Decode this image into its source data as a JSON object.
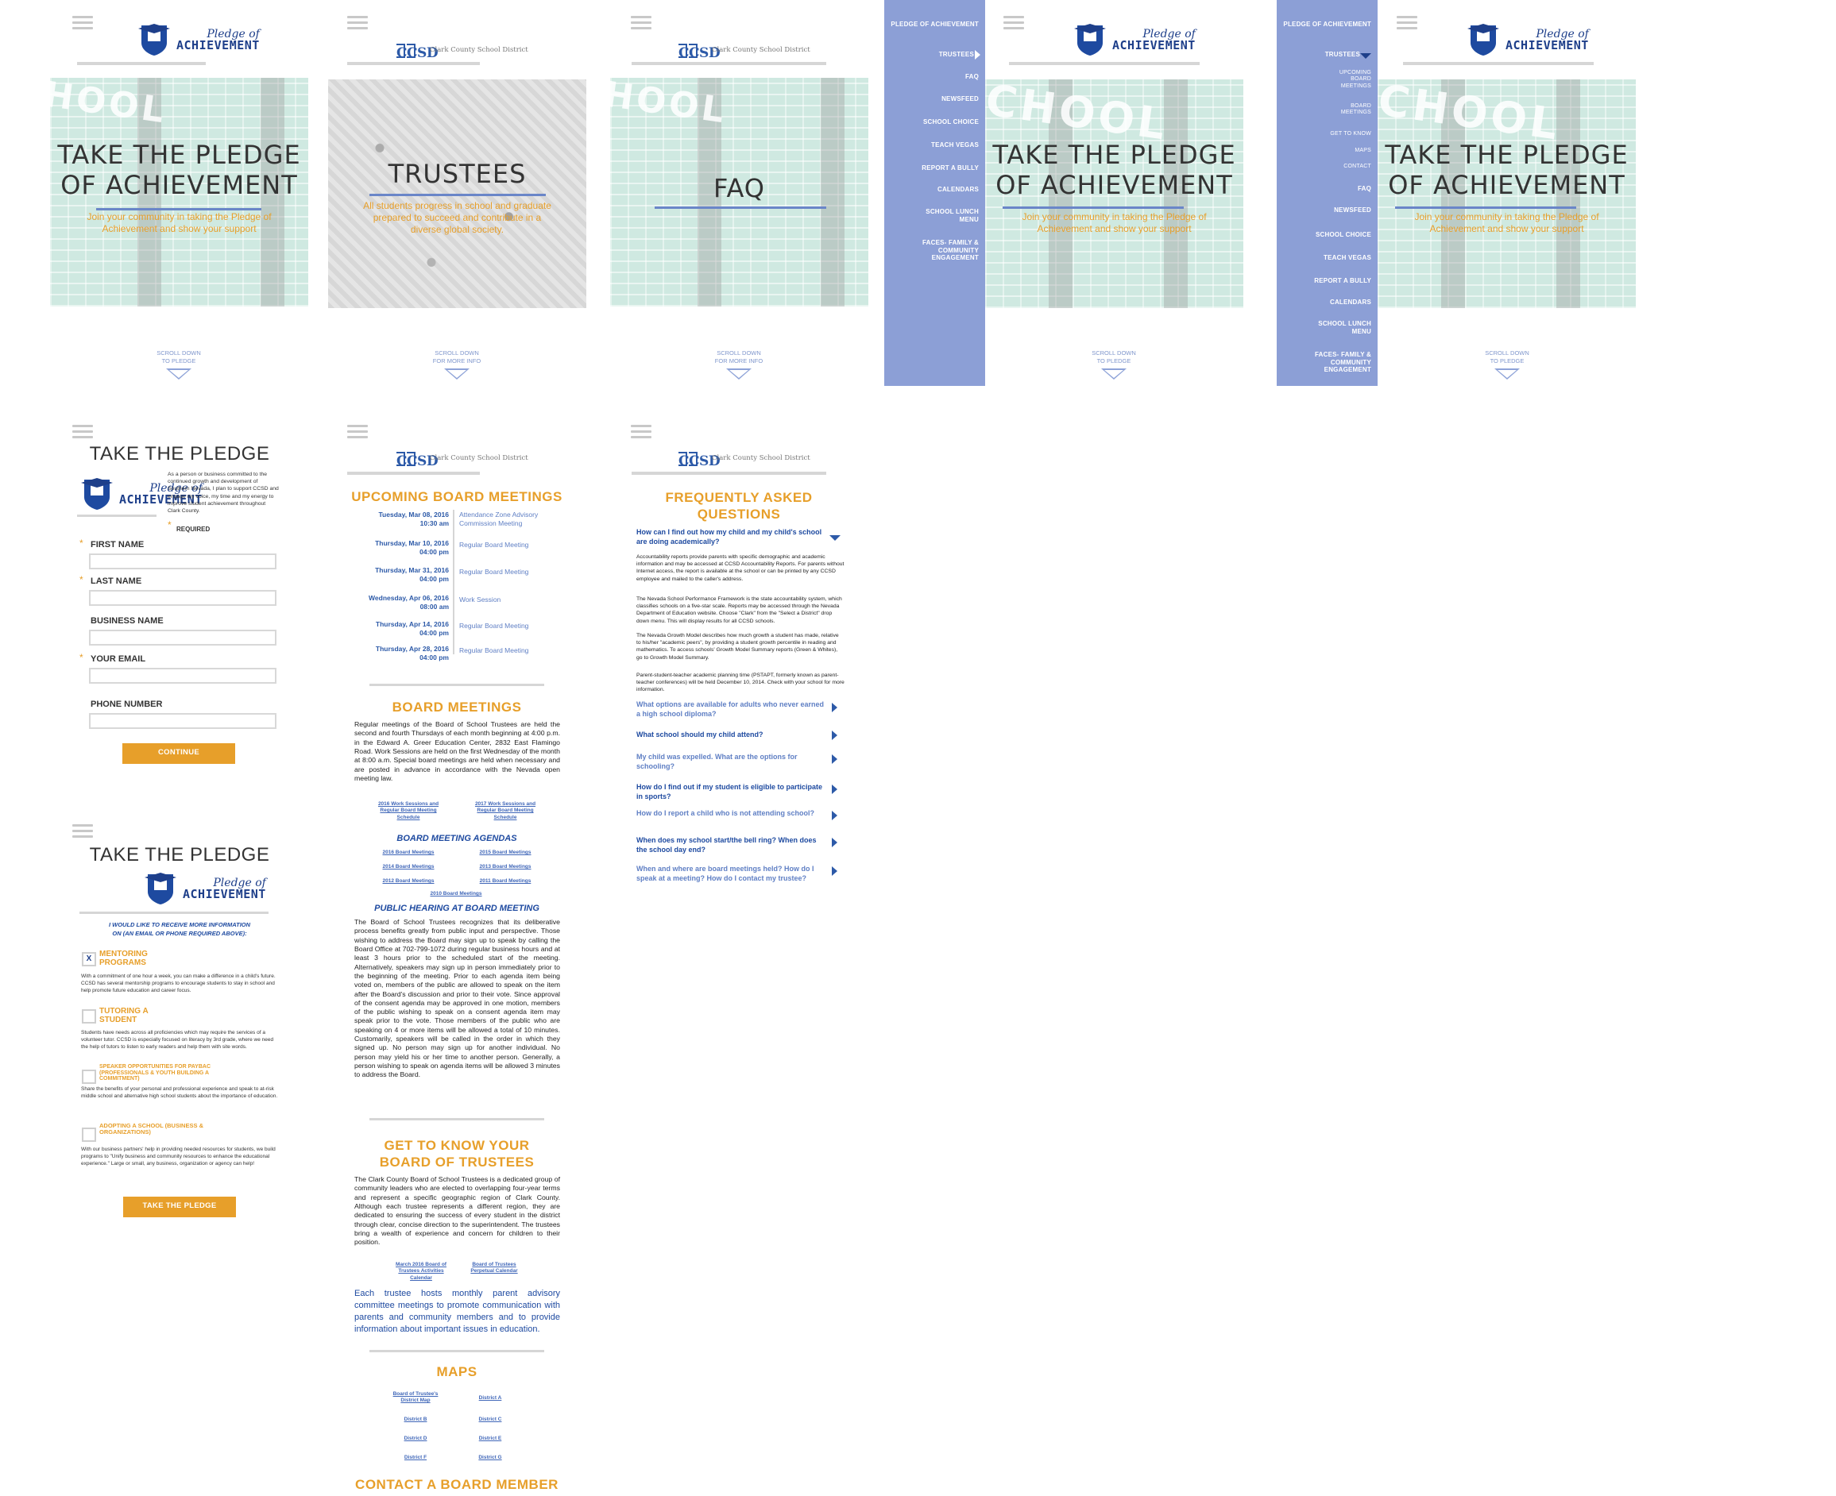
{
  "brand": {
    "logo_line1": "Pledge of",
    "logo_line2": "ACHIEVEMENT",
    "ccsd_mark": "CCSD",
    "ccsd_name": "Clark County School District"
  },
  "colors": {
    "nav_bg": "#8c9fd6",
    "accent_orange": "#e79f2a",
    "brand_blue": "#1e4aa0",
    "rule_blue": "#6a86c8"
  },
  "hero_pledge": {
    "title_line1": "TAKE THE PLEDGE",
    "title_line2": "OF ACHIEVEMENT",
    "subtitle_line1": "Join your community in taking the Pledge of",
    "subtitle_line2": "Achievement and show your support",
    "bg_word": "HOOL",
    "bg_word_big": "CHOOL",
    "scroll_line1": "SCROLL DOWN",
    "scroll_line2": "TO PLEDGE"
  },
  "hero_trustees": {
    "title": "TRUSTEES",
    "subtitle_line1": "All students progress in school and graduate",
    "subtitle_line2": "prepared to succeed and contribute in a",
    "subtitle_line3": "diverse global society.",
    "scroll_line1": "SCROLL DOWN",
    "scroll_line2": "FOR MORE INFO"
  },
  "hero_faq": {
    "title": "FAQ",
    "scroll_line1": "SCROLL DOWN",
    "scroll_line2": "FOR MORE INFO"
  },
  "nav_collapsed": {
    "items": [
      "PLEDGE OF ACHIEVEMENT",
      "TRUSTEES",
      "FAQ",
      "NEWSFEED",
      "SCHOOL CHOICE",
      "TEACH VEGAS",
      "REPORT A BULLY",
      "CALENDARS",
      "SCHOOL LUNCH MENU",
      "FACES- FAMILY & COMMUNITY ENGAGEMENT"
    ]
  },
  "nav_expanded": {
    "items": [
      "PLEDGE OF ACHIEVEMENT",
      "TRUSTEES"
    ],
    "subitems": [
      "UPCOMING BOARD MEETINGS",
      "BOARD MEETINGS",
      "GET TO KNOW",
      "MAPS",
      "CONTACT"
    ],
    "rest": [
      "FAQ",
      "NEWSFEED",
      "SCHOOL CHOICE",
      "TEACH VEGAS",
      "REPORT A BULLY",
      "CALENDARS",
      "SCHOOL LUNCH MENU",
      "FACES- FAMILY & COMMUNITY ENGAGEMENT"
    ]
  },
  "pledge_form": {
    "title": "TAKE THE PLEDGE",
    "intro": "As a person or business committed to the continued growth and development of Southern Nevada, I plan to support CCSD and engage my voice, my time and my energy to improve student achievement throughout Clark County.",
    "required": "REQUIRED",
    "fields": [
      "FIRST NAME",
      "LAST NAME",
      "BUSINESS NAME",
      "YOUR EMAIL",
      "PHONE NUMBER"
    ],
    "continue": "CONTINUE"
  },
  "pledge_options": {
    "title": "TAKE THE PLEDGE",
    "prompt_line1": "I WOULD LIKE TO RECEIVE MORE INFORMATION",
    "prompt_line2": "ON (AN EMAIL OR PHONE REQUIRED ABOVE):",
    "options": [
      {
        "title": "MENTORING PROGRAMS",
        "checked_mark": "X",
        "desc": "With a commitment of one hour a week, you can make a difference in a child's future. CCSD has several mentorship programs to encourage students to stay in school and help promote future education and career focus."
      },
      {
        "title": "TUTORING A STUDENT",
        "checked_mark": "",
        "desc": "Students have needs across all proficiencies which may require the services of a volunteer tutor. CCSD is especially focused on literacy by 3rd grade, where we need the help of tutors to listen to early readers and help them with site words."
      },
      {
        "title": "SPEAKER OPPORTUNITIES FOR PAYBAC (PROFESSIONALS & YOUTH BUILDING A COMMITMENT)",
        "checked_mark": "",
        "desc": "Share the benefits of your personal and professional experience and speak to at-risk middle school and alternative high school students about the importance of education."
      },
      {
        "title": "ADOPTING A SCHOOL (BUSINESS & ORGANIZATIONS)",
        "checked_mark": "",
        "desc": "With our business partners' help in providing needed resources for students, we build programs to \"Unify business and community resources to enhance the educational experience.\" Large or small, any business, organization or agency can help!"
      }
    ],
    "submit": "TAKE THE PLEDGE"
  },
  "trustees_page": {
    "upcoming_title": "UPCOMING BOARD MEETINGS",
    "meetings": [
      {
        "date": "Tuesday, Mar 08, 2016",
        "time": "10:30 am",
        "name": "Attendance Zone Advisory Commission Meeting"
      },
      {
        "date": "Thursday, Mar 10, 2016",
        "time": "04:00 pm",
        "name": "Regular Board Meeting"
      },
      {
        "date": "Thursday, Mar 31, 2016",
        "time": "04:00 pm",
        "name": "Regular Board Meeting"
      },
      {
        "date": "Wednesday, Apr 06, 2016",
        "time": "08:00 am",
        "name": "Work Session"
      },
      {
        "date": "Thursday, Apr 14, 2016",
        "time": "04:00 pm",
        "name": "Regular Board Meeting"
      },
      {
        "date": "Thursday, Apr 28, 2016",
        "time": "04:00 pm",
        "name": "Regular Board Meeting"
      }
    ],
    "board_title": "BOARD MEETINGS",
    "board_text": "Regular meetings of the Board of School Trustees are held the second and fourth Thursdays of each month beginning at 4:00 p.m. in the Edward A. Greer Education Center, 2832 East Flamingo Road. Work Sessions are held on the first Wednesday of the month at 8:00 a.m. Special board meetings are held when necessary and are posted in advance in accordance with the Nevada open meeting law.",
    "schedule_links": [
      "2016 Work Sessions and Regular Board Meeting Schedule",
      "2017 Work Sessions and Regular Board Meeting Schedule"
    ],
    "agendas_title": "BOARD MEETING AGENDAS",
    "agenda_links": [
      "2016 Board Meetings",
      "2015 Board Meetings",
      "2014 Board Meetings",
      "2013 Board Meetings",
      "2012 Board Meetings",
      "2011 Board Meetings",
      "2010 Board Meetings"
    ],
    "hearing_title": "PUBLIC HEARING AT BOARD MEETING",
    "hearing_text": "The Board of School Trustees recognizes that its deliberative process benefits greatly from public input and perspective. Those wishing to address the Board may sign up to speak by calling the Board Office at 702-799-1072 during regular business hours and at least 3 hours prior to the scheduled start of the meeting. Alternatively, speakers may sign up in person immediately prior to the beginning of the meeting. Prior to each agenda item being voted on, members of the public are allowed to speak on the item after the Board's discussion and prior to their vote. Since approval of the consent agenda may be approved in one motion, members of the public wishing to speak on a consent agenda item may speak prior to the vote. Those members of the public who are speaking on 4 or more items will be allowed a total of 10 minutes. Customarily, speakers will be called in the order in which they signed up. No person may sign up for another individual. No person may yield his or her time to another person. Generally, a person wishing to speak on agenda items will be allowed 3 minutes to address the Board.",
    "know_title_line1": "GET TO KNOW YOUR",
    "know_title_line2": "BOARD OF TRUSTEES",
    "know_text": "The Clark County Board of School Trustees is a dedicated group of community leaders who are elected to overlapping four-year terms and represent a specific geographic region of Clark County. Although each trustee represents a different region, they are dedicated to ensuring the success of every student in the district through clear, concise direction to the superintendent. The trustees bring a wealth of experience and concern for children to their position.",
    "calendar_links": [
      "March 2016 Board of Trustees Activities Calendar",
      "Board of Trustees Perpetual Calendar"
    ],
    "advisory_text": "Each trustee hosts monthly parent advisory committee meetings to promote communication with parents and community members and to provide information about important issues in education.",
    "maps_title": "MAPS",
    "map_links": [
      "Board of Trustee's District Map",
      "District A",
      "District B",
      "District C",
      "District D",
      "District E",
      "District F",
      "District G"
    ],
    "contact_title": "CONTACT A BOARD MEMBER"
  },
  "faq_page": {
    "title_line1": "FREQUENTLY ASKED",
    "title_line2": "QUESTIONS",
    "open_question": "How can I find out how my child and my child's school are doing academically?",
    "answers": [
      "Accountability reports provide parents with specific demographic and academic information and may be accessed at CCSD Accountability Reports. For parents without Internet access, the report is available at the school or can be printed by any CCSD employee and mailed to the caller's address.",
      "The Nevada School Performance Framework is the state accountability system, which classifies schools on a five-star scale. Reports may be accessed through the Nevada Department of Education website. Choose \"Clark\" from the \"Select a District\" drop down menu. This will display results for all CCSD schools.",
      "The Nevada Growth Model describes how much growth a student has made, relative to his/her \"academic peers\", by providing a student growth percentile in reading and mathematics. To access schools' Growth Model Summary reports (Green & Whites), go to Growth Model Summary.",
      "Parent-student-teacher academic planning time (PSTAPT, formerly known as parent-teacher conferences) will be held December 10, 2014. Check with your school for more information."
    ],
    "questions": [
      "What options are available for adults who never earned a high school diploma?",
      "What school should my child attend?",
      "My child was expelled. What are the options for schooling?",
      "How do I find out if my student is eligible to participate in sports?",
      "How do I report a child who is not attending school?",
      "When does my school start/the bell ring? When does the school day end?",
      "When and where are board meetings held? How do I speak at a meeting? How do I contact my trustee?"
    ]
  }
}
